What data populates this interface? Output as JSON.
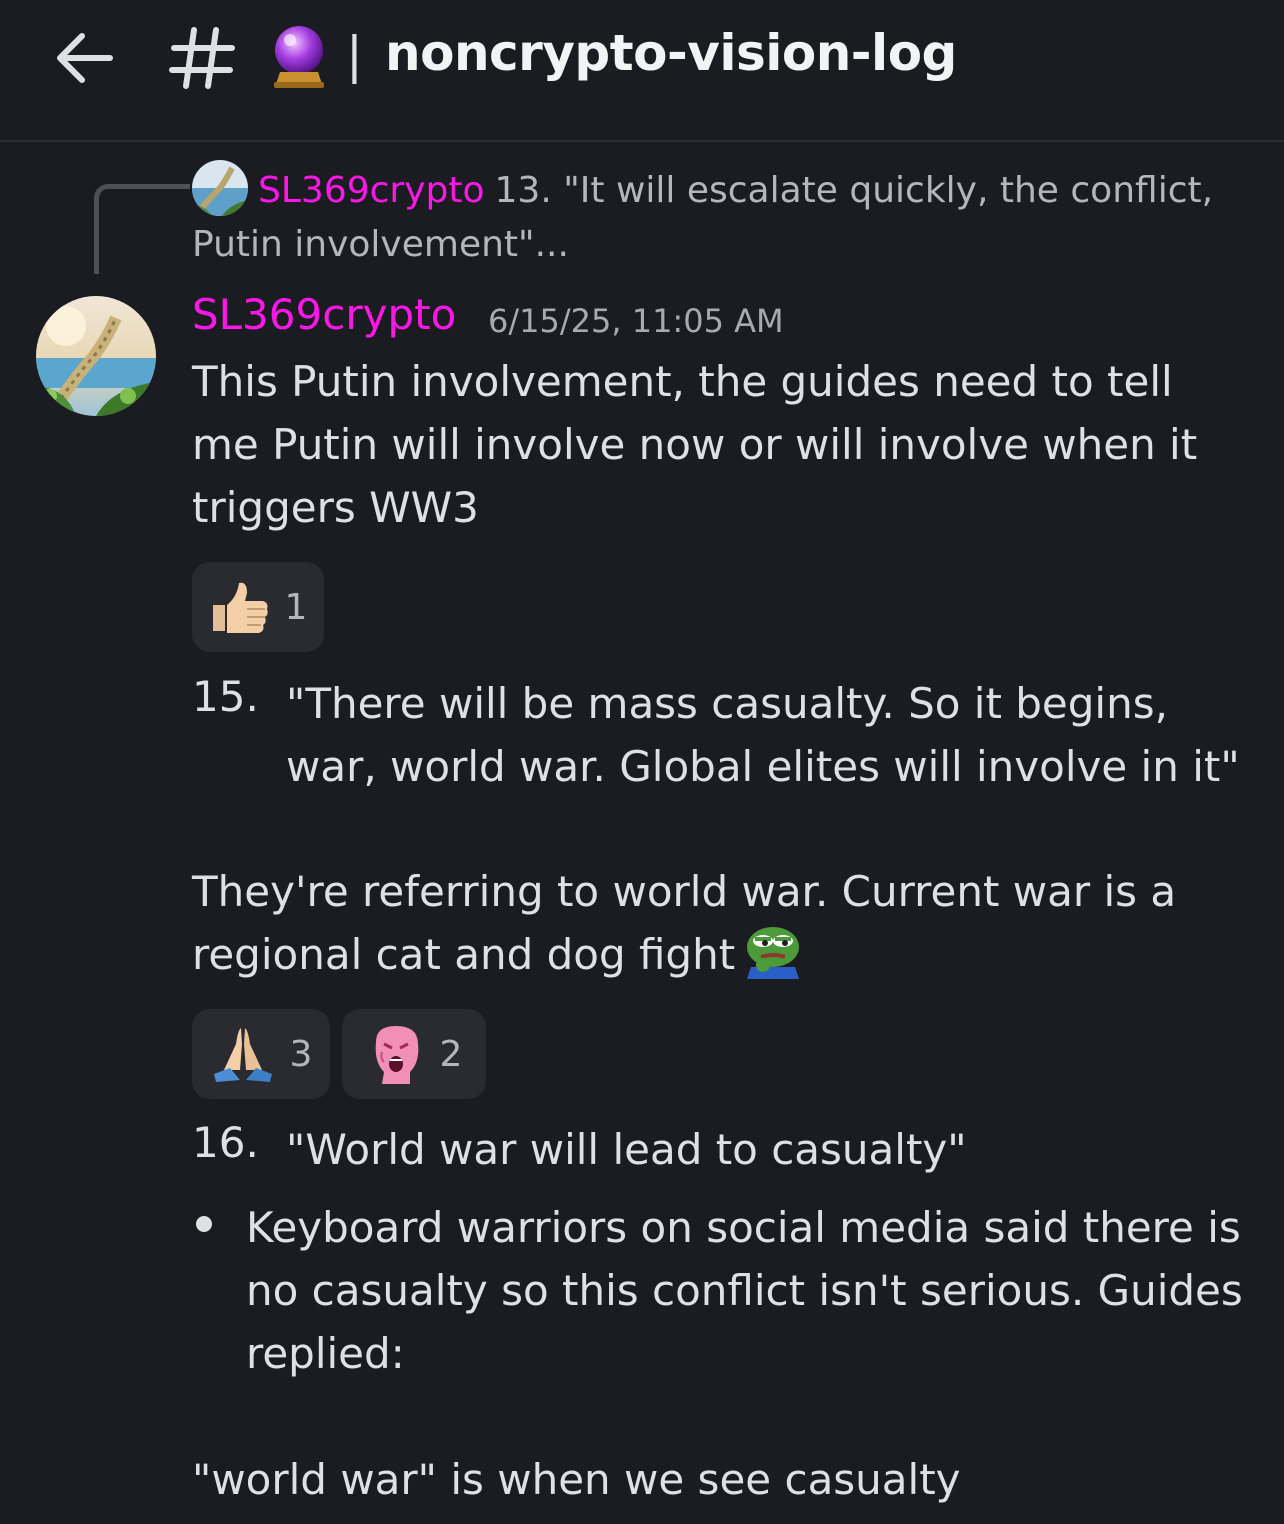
{
  "header": {
    "hash": "#",
    "pipe": "|",
    "channel_name": "noncrypto-vision-log",
    "icons": [
      "back-arrow-icon",
      "hashtag-icon",
      "crystal-ball-icon"
    ]
  },
  "reply": {
    "author": "SL369crypto",
    "text": "13.  \"It will escalate quickly, the conflict, Putin involvement\"..."
  },
  "message": {
    "author": "SL369crypto",
    "timestamp": "6/15/25, 11:05 AM",
    "paragraph1": "This Putin involvement, the guides need to tell me Putin will involve now or will involve when it triggers WW3",
    "reactions1": [
      {
        "emoji": "thumbs-up-icon",
        "count": "1"
      }
    ],
    "item15_num": "15.",
    "item15_text": "\"There will be mass casualty. So it begins, war, world war. Global elites will involve in it\"",
    "paragraph2": "They're referring to world war.  Current war is a regional cat and dog fight",
    "paragraph2_emoji": "pepe-thinking-icon",
    "reactions2": [
      {
        "emoji": "praying-hands-icon",
        "count": "3"
      },
      {
        "emoji": "pink-wojak-icon",
        "count": "2"
      }
    ],
    "item16_num": "16.",
    "item16_text": "\"World war will lead to casualty\"",
    "bullet_text": "Keyboard warriors on social media said there is no casualty so this conflict isn't serious.  Guides replied:",
    "paragraph3": "\"world war\" is when we see casualty"
  },
  "colors": {
    "background": "#1b1c21",
    "username": "#ff17e8",
    "text": "#dfe0e4",
    "muted": "#a8a9b0",
    "reaction_bg": "#2a2b31"
  }
}
